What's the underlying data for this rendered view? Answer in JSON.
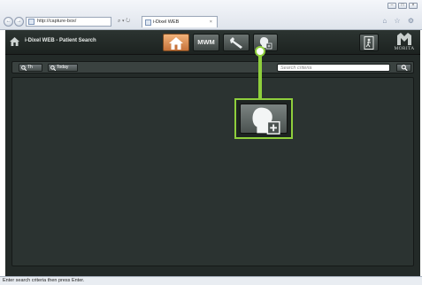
{
  "browser": {
    "address": "http://capture-box/",
    "address_buttons": "⌕ ▾ ↻",
    "tab_title": "i-Dixel WEB",
    "tab_close": "×",
    "win_controls": [
      "–",
      "□",
      "×"
    ],
    "nav_back": "←",
    "nav_forward": "→",
    "tools_glyphs": "⌂ ☆ ⚙"
  },
  "app": {
    "title": "i-Dixel WEB - Patient Search",
    "top_buttons": {
      "home_icon": "home-icon",
      "mwm_label": "MWM",
      "tools_icon": "wrench-icon",
      "patient_icon": "patient-add-icon",
      "exit_icon": "exit-door-icon"
    },
    "brand": "MORITA",
    "toolbar": {
      "th_label": "Th",
      "today_label": "Today",
      "search_placeholder": "Search criteria"
    }
  },
  "status_text": "Enter search criteria then press Enter.",
  "colors": {
    "accent": "#8fcf3c",
    "app_bg": "#232a28",
    "home_button": "#e08a4a"
  }
}
